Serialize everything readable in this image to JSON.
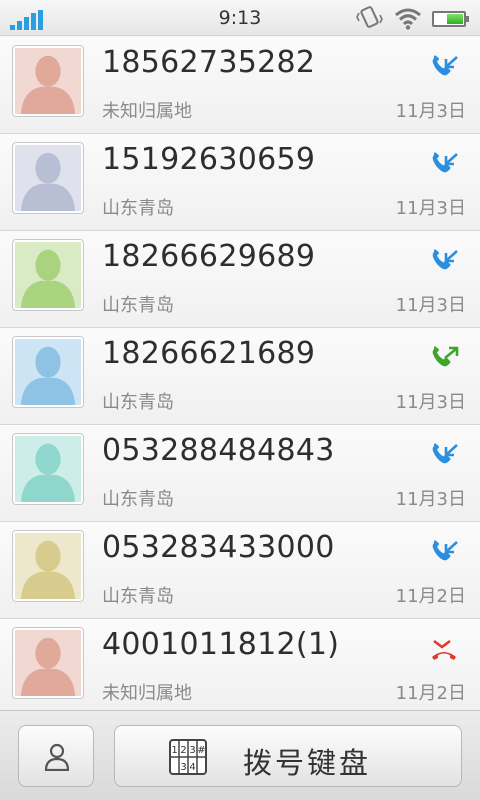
{
  "status_bar": {
    "time": "9:13"
  },
  "call_log": [
    {
      "number": "18562735282",
      "location": "未知归属地",
      "date": "11月3日",
      "call_type": "incoming",
      "avatar_color": "#e0a99a"
    },
    {
      "number": "15192630659",
      "location": "山东青岛",
      "date": "11月3日",
      "call_type": "incoming",
      "avatar_color": "#b8bfd4"
    },
    {
      "number": "18266629689",
      "location": "山东青岛",
      "date": "11月3日",
      "call_type": "incoming",
      "avatar_color": "#a9d37f"
    },
    {
      "number": "18266621689",
      "location": "山东青岛",
      "date": "11月3日",
      "call_type": "outgoing",
      "avatar_color": "#8fc3e6"
    },
    {
      "number": "053288484843",
      "location": "山东青岛",
      "date": "11月3日",
      "call_type": "incoming",
      "avatar_color": "#8fd6cc"
    },
    {
      "number": "053283433000",
      "location": "山东青岛",
      "date": "11月2日",
      "call_type": "incoming",
      "avatar_color": "#d7cb8d"
    },
    {
      "number": "4001011812(1)",
      "location": "未知归属地",
      "date": "11月2日",
      "call_type": "missed",
      "avatar_color": "#e0a99a"
    }
  ],
  "icon_colors": {
    "incoming": "#2a8fe0",
    "outgoing": "#3fa52a",
    "missed": "#e03a2a"
  },
  "bottom_bar": {
    "dialpad_label": "拨号键盘",
    "contacts_icon": "person-icon",
    "dialpad_icon": "keypad-icon"
  }
}
